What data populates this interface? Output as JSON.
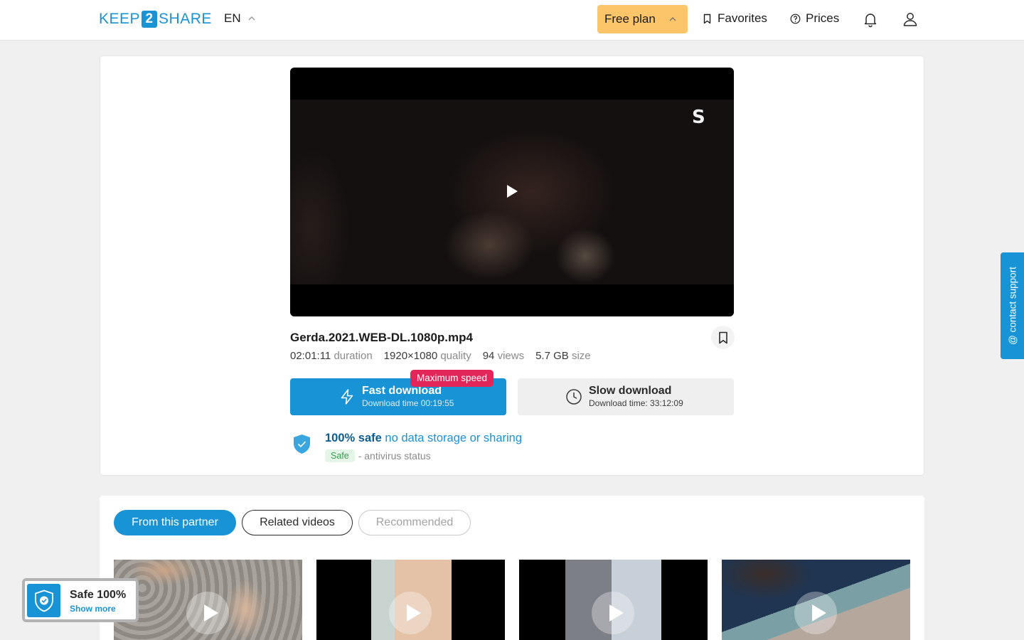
{
  "header": {
    "logo": {
      "part1": "KEEP",
      "part2": "2",
      "part3": "SHARE"
    },
    "language": "EN",
    "plan_label": "Free plan",
    "favorites_label": "Favorites",
    "prices_label": "Prices"
  },
  "player": {
    "watermark": "S"
  },
  "file": {
    "name": "Gerda.2021.WEB-DL.1080p.mp4",
    "duration_value": "02:01:11",
    "duration_label": "duration",
    "quality_value": "1920×1080",
    "quality_label": "quality",
    "views_value": "94",
    "views_label": "views",
    "size_value": "5.7 GB",
    "size_label": "size"
  },
  "download": {
    "badge": "Maximum speed",
    "fast_title": "Fast download",
    "fast_time": "Download time 00:19:55",
    "slow_title": "Slow download",
    "slow_time": "Download time: 33:12:09"
  },
  "safety": {
    "strong": "100% safe",
    "light": "no data storage or sharing",
    "status_badge": "Safe",
    "status_text": "- antivirus status"
  },
  "tabs": {
    "partner": "From this partner",
    "related": "Related videos",
    "recommended": "Recommended"
  },
  "support": {
    "label": "@ contact support"
  },
  "safe_widget": {
    "title": "Safe 100%",
    "link": "Show more"
  },
  "colors": {
    "brand_blue": "#1893d6",
    "plan_yellow": "#fcc56a",
    "badge_red": "#e3265a"
  },
  "icons": [
    "chevron-up-icon",
    "bookmark-icon",
    "question-circle-icon",
    "bell-icon",
    "user-icon",
    "play-icon",
    "lightning-icon",
    "clock-icon",
    "shield-check-icon"
  ]
}
